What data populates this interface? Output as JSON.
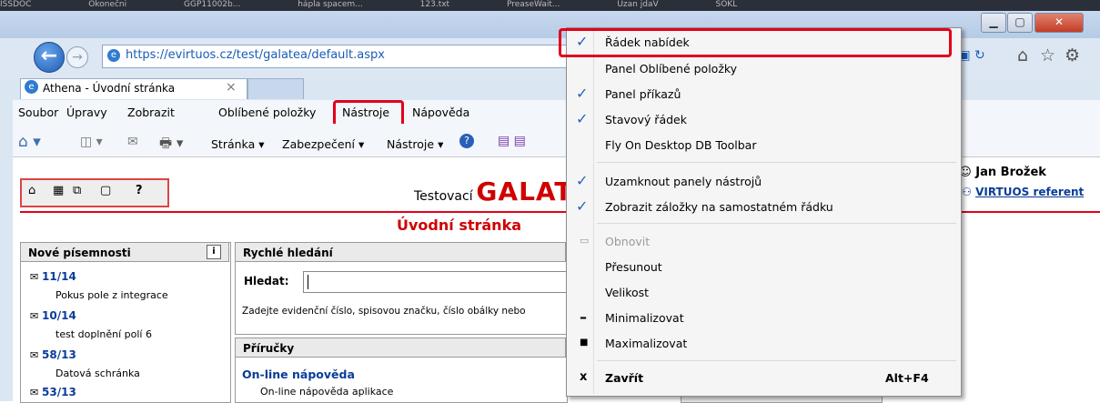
{
  "taskbar": {
    "items": [
      "ISSDOC",
      "Okonečni",
      "GGP11002b...",
      "hápla spacem...",
      "123.txt",
      "PreaseWait...",
      "Uzan jdaV",
      "SOKL"
    ]
  },
  "browser": {
    "address": "https://evirtuos.cz/test/galatea/default.aspx",
    "address_host": "evirtuos.cz",
    "tab_title": "Athena - Úvodní stránka",
    "tab_close": "×"
  },
  "menubar": {
    "items": [
      "Soubor",
      "Úpravy",
      "Zobrazit",
      "Oblíbené položky",
      "Nástroje",
      "Nápověda"
    ]
  },
  "commandbar": {
    "page": "Stránka ▾",
    "security": "Zabezpečení ▾",
    "tools": "Nástroje ▾"
  },
  "page": {
    "brand_prefix": "Testovací",
    "brand_name": "GALAT",
    "home_title": "Úvodní stránka",
    "help_icon_label": "?",
    "user_label": "Jan Brožek",
    "role_label": "VIRTUOS referent",
    "user_prefix": "l:",
    "role_prefix": "e:",
    "new_docs_title": "Nové písemnosti",
    "info_btn": "i",
    "docs": [
      {
        "id": "11/14",
        "desc": "Pokus pole z integrace"
      },
      {
        "id": "10/14",
        "desc": "test doplnění polí 6"
      },
      {
        "id": "58/13",
        "desc": "Datová schránka"
      },
      {
        "id": "53/13",
        "desc": ""
      }
    ],
    "quick_search_title": "Rychlé hledání",
    "search_label": "Hledat:",
    "search_value": "",
    "search_hint": "Zadejte evidenční číslo, spisovou značku, číslo obálky nebo",
    "manuals_title": "Příručky",
    "manual_link": "On-line nápověda",
    "manual_desc": "On-line nápověda aplikace"
  },
  "context_menu": {
    "items": [
      {
        "label": "Řádek nabídek",
        "checked": true,
        "icon": "check-icon",
        "shortcut": ""
      },
      {
        "label": "Panel Oblíbené položky",
        "checked": false,
        "icon": "",
        "shortcut": ""
      },
      {
        "label": "Panel příkazů",
        "checked": true,
        "icon": "check-icon",
        "shortcut": ""
      },
      {
        "label": "Stavový řádek",
        "checked": true,
        "icon": "check-icon",
        "shortcut": ""
      },
      {
        "label": "Fly On Desktop DB Toolbar",
        "checked": false,
        "icon": "",
        "shortcut": ""
      },
      {
        "label": "Uzamknout panely nástrojů",
        "checked": true,
        "icon": "check-icon",
        "shortcut": ""
      },
      {
        "label": "Zobrazit záložky na samostatném řádku",
        "checked": true,
        "icon": "check-icon",
        "shortcut": ""
      },
      {
        "label": "Obnovit",
        "checked": false,
        "icon": "restore-icon",
        "shortcut": "",
        "disabled": true
      },
      {
        "label": "Přesunout",
        "checked": false,
        "icon": "",
        "shortcut": ""
      },
      {
        "label": "Velikost",
        "checked": false,
        "icon": "",
        "shortcut": ""
      },
      {
        "label": "Minimalizovat",
        "checked": false,
        "icon": "minimize-icon",
        "shortcut": ""
      },
      {
        "label": "Maximalizovat",
        "checked": false,
        "icon": "maximize-icon",
        "shortcut": ""
      },
      {
        "label": "Zavřít",
        "checked": false,
        "icon": "close-icon",
        "shortcut": "Alt+F4"
      }
    ]
  },
  "colors": {
    "highlight": "#e1001a",
    "link": "#0a3c9a",
    "title_red": "#d00000"
  }
}
